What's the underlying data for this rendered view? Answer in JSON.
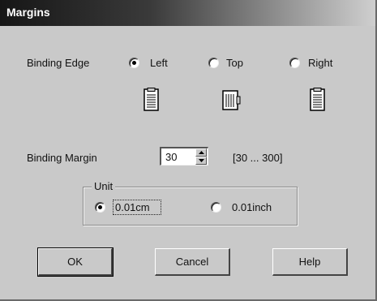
{
  "window": {
    "title": "Margins"
  },
  "binding_edge": {
    "label": "Binding Edge",
    "options": [
      {
        "label": "Left",
        "checked": true,
        "icon": "document-left-binding-icon"
      },
      {
        "label": "Top",
        "checked": false,
        "icon": "document-top-binding-icon"
      },
      {
        "label": "Right",
        "checked": false,
        "icon": "document-right-binding-icon"
      }
    ]
  },
  "binding_margin": {
    "label": "Binding Margin",
    "value": "30",
    "range": "[30 ... 300]"
  },
  "unit": {
    "legend": "Unit",
    "options": [
      {
        "label": "0.01cm",
        "checked": true
      },
      {
        "label": "0.01inch",
        "checked": false
      }
    ]
  },
  "buttons": {
    "ok": "OK",
    "cancel": "Cancel",
    "help": "Help"
  }
}
